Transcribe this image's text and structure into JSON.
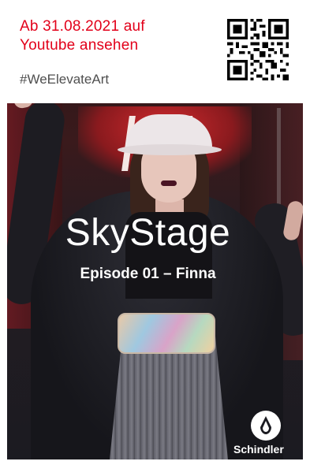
{
  "card": {
    "line1": "Ab 31.08.2021 auf",
    "line2": "Youtube ansehen",
    "hashtag": "#WeElevateArt",
    "qr_icon": "qr-code-icon"
  },
  "title": "SkyStage",
  "subtitle": "Episode 01 – Finna",
  "brand": {
    "name": "Schindler",
    "logo_icon": "schindler-logo-icon"
  },
  "colors": {
    "accent": "#e2001a",
    "text_light": "#ffffff",
    "hashtag": "#4f4f4f"
  }
}
